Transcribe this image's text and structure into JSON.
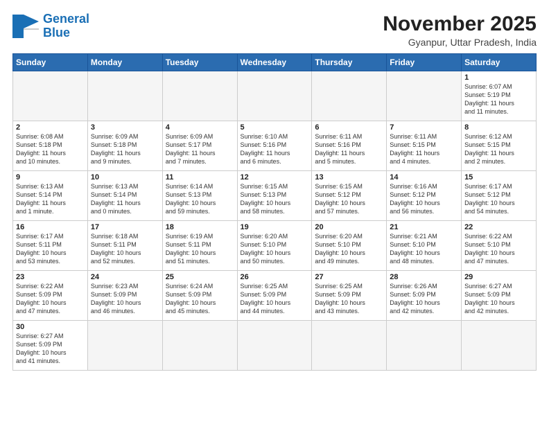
{
  "logo": {
    "line1": "General",
    "line2": "Blue"
  },
  "title": "November 2025",
  "subtitle": "Gyanpur, Uttar Pradesh, India",
  "days_of_week": [
    "Sunday",
    "Monday",
    "Tuesday",
    "Wednesday",
    "Thursday",
    "Friday",
    "Saturday"
  ],
  "weeks": [
    [
      {
        "day": "",
        "info": ""
      },
      {
        "day": "",
        "info": ""
      },
      {
        "day": "",
        "info": ""
      },
      {
        "day": "",
        "info": ""
      },
      {
        "day": "",
        "info": ""
      },
      {
        "day": "",
        "info": ""
      },
      {
        "day": "1",
        "info": "Sunrise: 6:07 AM\nSunset: 5:19 PM\nDaylight: 11 hours\nand 11 minutes."
      }
    ],
    [
      {
        "day": "2",
        "info": "Sunrise: 6:08 AM\nSunset: 5:18 PM\nDaylight: 11 hours\nand 10 minutes."
      },
      {
        "day": "3",
        "info": "Sunrise: 6:09 AM\nSunset: 5:18 PM\nDaylight: 11 hours\nand 9 minutes."
      },
      {
        "day": "4",
        "info": "Sunrise: 6:09 AM\nSunset: 5:17 PM\nDaylight: 11 hours\nand 7 minutes."
      },
      {
        "day": "5",
        "info": "Sunrise: 6:10 AM\nSunset: 5:16 PM\nDaylight: 11 hours\nand 6 minutes."
      },
      {
        "day": "6",
        "info": "Sunrise: 6:11 AM\nSunset: 5:16 PM\nDaylight: 11 hours\nand 5 minutes."
      },
      {
        "day": "7",
        "info": "Sunrise: 6:11 AM\nSunset: 5:15 PM\nDaylight: 11 hours\nand 4 minutes."
      },
      {
        "day": "8",
        "info": "Sunrise: 6:12 AM\nSunset: 5:15 PM\nDaylight: 11 hours\nand 2 minutes."
      }
    ],
    [
      {
        "day": "9",
        "info": "Sunrise: 6:13 AM\nSunset: 5:14 PM\nDaylight: 11 hours\nand 1 minute."
      },
      {
        "day": "10",
        "info": "Sunrise: 6:13 AM\nSunset: 5:14 PM\nDaylight: 11 hours\nand 0 minutes."
      },
      {
        "day": "11",
        "info": "Sunrise: 6:14 AM\nSunset: 5:13 PM\nDaylight: 10 hours\nand 59 minutes."
      },
      {
        "day": "12",
        "info": "Sunrise: 6:15 AM\nSunset: 5:13 PM\nDaylight: 10 hours\nand 58 minutes."
      },
      {
        "day": "13",
        "info": "Sunrise: 6:15 AM\nSunset: 5:12 PM\nDaylight: 10 hours\nand 57 minutes."
      },
      {
        "day": "14",
        "info": "Sunrise: 6:16 AM\nSunset: 5:12 PM\nDaylight: 10 hours\nand 56 minutes."
      },
      {
        "day": "15",
        "info": "Sunrise: 6:17 AM\nSunset: 5:12 PM\nDaylight: 10 hours\nand 54 minutes."
      }
    ],
    [
      {
        "day": "16",
        "info": "Sunrise: 6:17 AM\nSunset: 5:11 PM\nDaylight: 10 hours\nand 53 minutes."
      },
      {
        "day": "17",
        "info": "Sunrise: 6:18 AM\nSunset: 5:11 PM\nDaylight: 10 hours\nand 52 minutes."
      },
      {
        "day": "18",
        "info": "Sunrise: 6:19 AM\nSunset: 5:11 PM\nDaylight: 10 hours\nand 51 minutes."
      },
      {
        "day": "19",
        "info": "Sunrise: 6:20 AM\nSunset: 5:10 PM\nDaylight: 10 hours\nand 50 minutes."
      },
      {
        "day": "20",
        "info": "Sunrise: 6:20 AM\nSunset: 5:10 PM\nDaylight: 10 hours\nand 49 minutes."
      },
      {
        "day": "21",
        "info": "Sunrise: 6:21 AM\nSunset: 5:10 PM\nDaylight: 10 hours\nand 48 minutes."
      },
      {
        "day": "22",
        "info": "Sunrise: 6:22 AM\nSunset: 5:10 PM\nDaylight: 10 hours\nand 47 minutes."
      }
    ],
    [
      {
        "day": "23",
        "info": "Sunrise: 6:22 AM\nSunset: 5:09 PM\nDaylight: 10 hours\nand 47 minutes."
      },
      {
        "day": "24",
        "info": "Sunrise: 6:23 AM\nSunset: 5:09 PM\nDaylight: 10 hours\nand 46 minutes."
      },
      {
        "day": "25",
        "info": "Sunrise: 6:24 AM\nSunset: 5:09 PM\nDaylight: 10 hours\nand 45 minutes."
      },
      {
        "day": "26",
        "info": "Sunrise: 6:25 AM\nSunset: 5:09 PM\nDaylight: 10 hours\nand 44 minutes."
      },
      {
        "day": "27",
        "info": "Sunrise: 6:25 AM\nSunset: 5:09 PM\nDaylight: 10 hours\nand 43 minutes."
      },
      {
        "day": "28",
        "info": "Sunrise: 6:26 AM\nSunset: 5:09 PM\nDaylight: 10 hours\nand 42 minutes."
      },
      {
        "day": "29",
        "info": "Sunrise: 6:27 AM\nSunset: 5:09 PM\nDaylight: 10 hours\nand 42 minutes."
      }
    ],
    [
      {
        "day": "30",
        "info": "Sunrise: 6:27 AM\nSunset: 5:09 PM\nDaylight: 10 hours\nand 41 minutes."
      },
      {
        "day": "",
        "info": ""
      },
      {
        "day": "",
        "info": ""
      },
      {
        "day": "",
        "info": ""
      },
      {
        "day": "",
        "info": ""
      },
      {
        "day": "",
        "info": ""
      },
      {
        "day": "",
        "info": ""
      }
    ]
  ]
}
